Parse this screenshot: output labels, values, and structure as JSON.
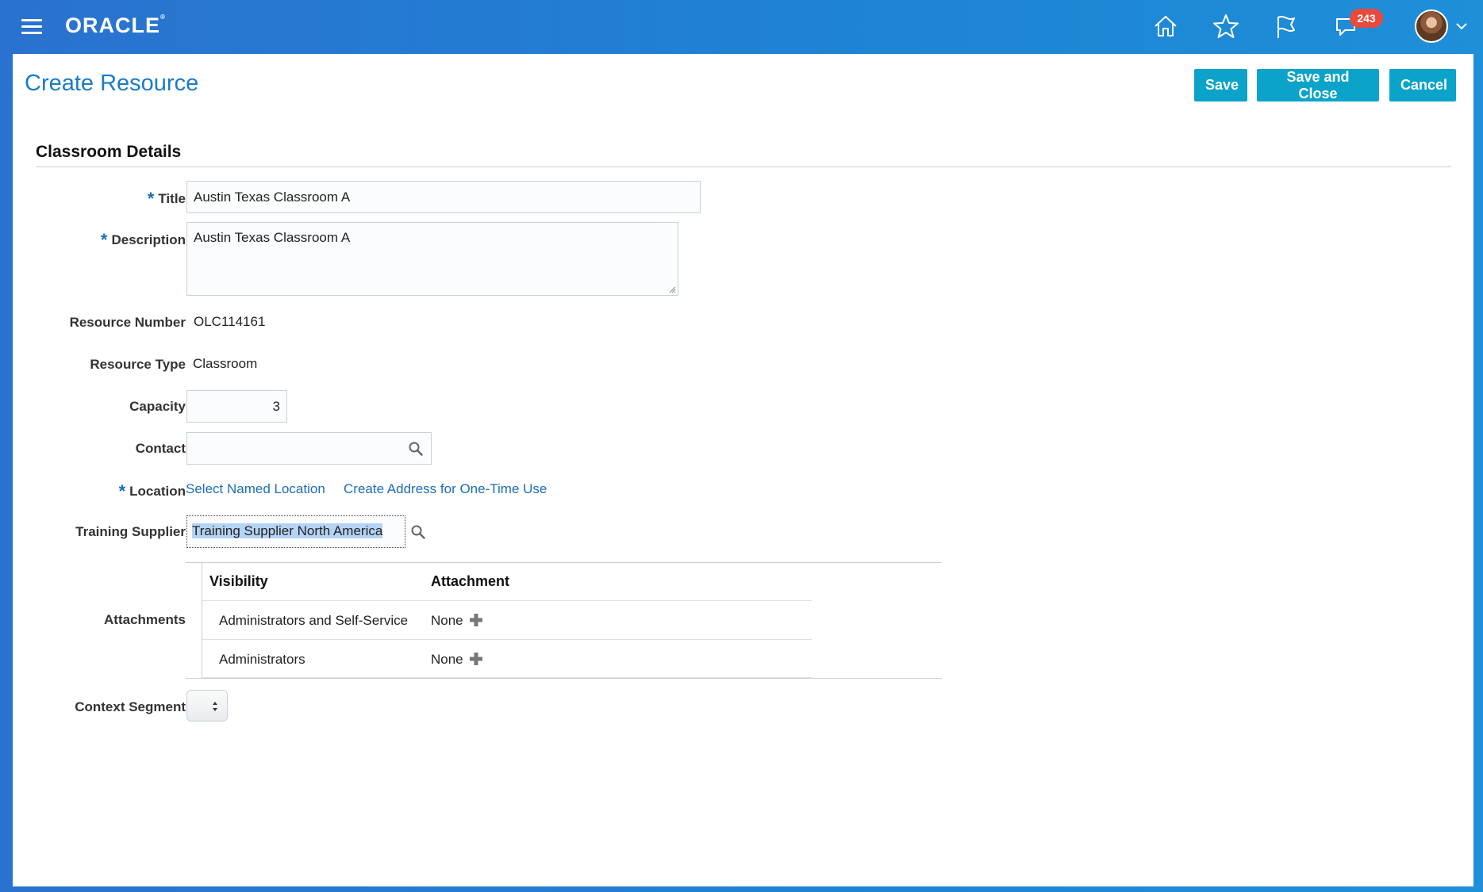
{
  "header": {
    "logo_text": "ORACLE",
    "logo_mark": "®",
    "notification_count": "243",
    "icons": [
      "hamburger-menu-icon",
      "home-icon",
      "favorites-star-icon",
      "flag-icon",
      "notifications-icon",
      "avatar",
      "chevron-down-icon"
    ]
  },
  "page": {
    "title": "Create Resource",
    "buttons": {
      "save": "Save",
      "save_close": "Save and Close",
      "cancel": "Cancel"
    }
  },
  "section": {
    "title": "Classroom Details"
  },
  "form": {
    "required_mark": "*",
    "title_label": "Title",
    "title_value": "Austin Texas Classroom A",
    "description_label": "Description",
    "description_value": "Austin Texas Classroom A",
    "resource_number_label": "Resource Number",
    "resource_number_value": "OLC114161",
    "resource_type_label": "Resource Type",
    "resource_type_value": "Classroom",
    "capacity_label": "Capacity",
    "capacity_value": "3",
    "contact_label": "Contact",
    "contact_value": "",
    "location_label": "Location",
    "location_link_named": "Select Named Location",
    "location_link_address": "Create Address for One-Time Use",
    "training_supplier_label": "Training Supplier",
    "training_supplier_value": "Training Supplier North America",
    "attachments_label": "Attachments",
    "context_segment_label": "Context Segment",
    "context_segment_value": ""
  },
  "attachments": {
    "columns": [
      "Visibility",
      "Attachment"
    ],
    "rows": [
      {
        "visibility": "Administrators and Self-Service",
        "attachment": "None"
      },
      {
        "visibility": "Administrators",
        "attachment": "None"
      }
    ]
  },
  "colors": {
    "accent": "#1a7bc8",
    "button": "#0ba3c9",
    "badge": "#e84b3c",
    "link": "#1a6db8"
  }
}
